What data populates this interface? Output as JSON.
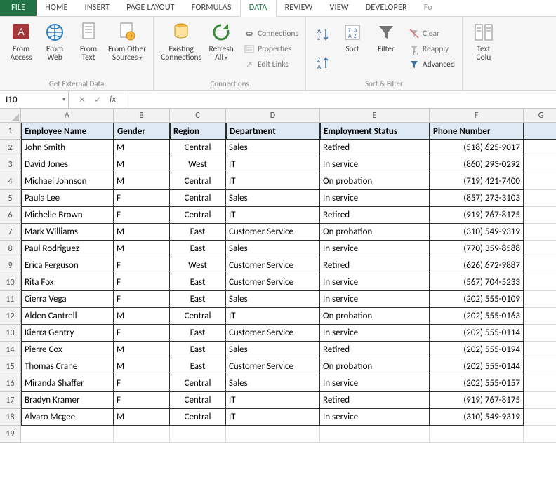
{
  "tabs": {
    "file": "FILE",
    "list": [
      "HOME",
      "INSERT",
      "PAGE LAYOUT",
      "FORMULAS",
      "DATA",
      "REVIEW",
      "VIEW",
      "DEVELOPER"
    ],
    "active_index": 4,
    "overflow": "Fo"
  },
  "ribbon": {
    "get_external": {
      "label": "Get External Data",
      "from_access": "From\nAccess",
      "from_web": "From\nWeb",
      "from_text": "From\nText",
      "from_other": "From Other\nSources"
    },
    "connections_group": {
      "label": "Connections",
      "existing": "Existing\nConnections",
      "refresh": "Refresh\nAll",
      "connections": "Connections",
      "properties": "Properties",
      "edit_links": "Edit Links"
    },
    "sort_filter": {
      "label": "Sort & Filter",
      "sort": "Sort",
      "filter": "Filter",
      "clear": "Clear",
      "reapply": "Reapply",
      "advanced": "Advanced"
    },
    "tools": {
      "text_to_cols": "Text\nColu"
    }
  },
  "formula_bar": {
    "name_box": "I10",
    "formula": ""
  },
  "sheet": {
    "columns": [
      "A",
      "B",
      "C",
      "D",
      "E",
      "F",
      "G"
    ],
    "headers": [
      "Employee Name",
      "Gender",
      "Region",
      "Department",
      "Employment Status",
      "Phone Number"
    ],
    "rows": [
      {
        "n": 1
      },
      {
        "n": 2,
        "d": [
          "John Smith",
          "M",
          "Central",
          "Sales",
          "Retired",
          "(518) 625-9017"
        ]
      },
      {
        "n": 3,
        "d": [
          "David Jones",
          "M",
          "West",
          "IT",
          "In service",
          "(860) 293-0292"
        ]
      },
      {
        "n": 4,
        "d": [
          "Michael Johnson",
          "M",
          "Central",
          "IT",
          "On probation",
          "(719) 421-7400"
        ]
      },
      {
        "n": 5,
        "d": [
          "Paula Lee",
          "F",
          "Central",
          "Sales",
          "In service",
          "(857) 273-3103"
        ]
      },
      {
        "n": 6,
        "d": [
          "Michelle Brown",
          "F",
          "Central",
          "IT",
          "Retired",
          "(919) 767-8175"
        ]
      },
      {
        "n": 7,
        "d": [
          "Mark Williams",
          "M",
          "East",
          "Customer Service",
          "On probation",
          "(310) 549-9319"
        ]
      },
      {
        "n": 8,
        "d": [
          "Paul Rodriguez",
          "M",
          "East",
          "Sales",
          "In service",
          "(770) 359-8588"
        ]
      },
      {
        "n": 9,
        "d": [
          "Erica Ferguson",
          "F",
          "West",
          "Customer Service",
          "Retired",
          "(626) 672-9887"
        ]
      },
      {
        "n": 10,
        "d": [
          "Rita Fox",
          "F",
          "East",
          "Customer Service",
          "In service",
          "(567) 704-5233"
        ]
      },
      {
        "n": 11,
        "d": [
          "Cierra Vega",
          "F",
          "East",
          "Sales",
          "In service",
          "(202) 555-0109"
        ]
      },
      {
        "n": 12,
        "d": [
          "Alden Cantrell",
          "M",
          "Central",
          "IT",
          "On probation",
          "(202) 555-0163"
        ]
      },
      {
        "n": 13,
        "d": [
          "Kierra Gentry",
          "F",
          "East",
          "Customer Service",
          "In service",
          "(202) 555-0114"
        ]
      },
      {
        "n": 14,
        "d": [
          "Pierre Cox",
          "M",
          "East",
          "Sales",
          "Retired",
          "(202) 555-0194"
        ]
      },
      {
        "n": 15,
        "d": [
          "Thomas Crane",
          "M",
          "East",
          "Customer Service",
          "On probation",
          "(202) 555-0144"
        ]
      },
      {
        "n": 16,
        "d": [
          "Miranda Shaffer",
          "F",
          "Central",
          "Sales",
          "In service",
          "(202) 555-0157"
        ]
      },
      {
        "n": 17,
        "d": [
          "Bradyn Kramer",
          "F",
          "Central",
          "IT",
          "Retired",
          "(919) 767-8175"
        ]
      },
      {
        "n": 18,
        "d": [
          "Alvaro Mcgee",
          "M",
          "Central",
          "IT",
          "In service",
          "(310) 549-9319"
        ]
      },
      {
        "n": 19
      }
    ]
  }
}
